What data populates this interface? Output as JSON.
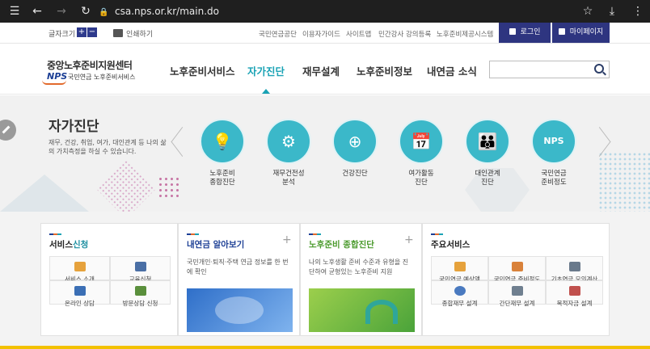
{
  "browser": {
    "url": "csa.nps.or.kr/main.do"
  },
  "util": {
    "font_size_label": "글자크기",
    "plus": "+",
    "minus": "−",
    "print_label": "인쇄하기",
    "links": [
      "국민연금공단",
      "이용자가이드",
      "사이트맵",
      "민간강사 강의등록",
      "노후준비제공시스템"
    ],
    "login": "로그인",
    "mypage": "마이페이지"
  },
  "header": {
    "logo_title": "중앙노후준비지원센터",
    "logo_nps": "NPS",
    "logo_sub": "국민연금 노후준비서비스",
    "nav": [
      "노후준비서비스",
      "자가진단",
      "재무설계",
      "노후준비정보",
      "내연금 소식"
    ],
    "search_placeholder": ""
  },
  "hero": {
    "title": "자가진단",
    "desc": "재무, 건강, 취업, 여가, 대인관계 등 나의 삶의 가치측정을 하실 수 있습니다.",
    "services": [
      {
        "label_line1": "노후준비",
        "label_line2": "종합진단",
        "icon": "lightbulb-icon",
        "glyph": "💡"
      },
      {
        "label_line1": "재무건전성",
        "label_line2": "분석",
        "icon": "gear-icon",
        "glyph": "⚙"
      },
      {
        "label_line1": "건강진단",
        "label_line2": "",
        "icon": "magnifier-plus-icon",
        "glyph": "⊕"
      },
      {
        "label_line1": "여가활동",
        "label_line2": "진단",
        "icon": "calendar-icon",
        "glyph": "📅"
      },
      {
        "label_line1": "대인관계",
        "label_line2": "진단",
        "icon": "people-icon",
        "glyph": "👪"
      },
      {
        "label_line1": "국민연금",
        "label_line2": "준비정도",
        "icon": "nps-hand-icon",
        "glyph": "NPS"
      }
    ]
  },
  "cards": {
    "service_apply": {
      "title_plain": "서비스",
      "title_hl": "신청",
      "items": [
        "서비스 소개",
        "교육신청",
        "온라인 상담",
        "방문상담 신청"
      ]
    },
    "my_pension": {
      "title": "내연금 알아보기",
      "desc": "국민개인·퇴직·주택 연금 정보를 한 번에 확인"
    },
    "overall_diag": {
      "title": "노후준비 종합진단",
      "desc": "나의 노후생활 준비 수준과 유형을 진단하여 균형있는 노후준비 지원"
    },
    "main_services": {
      "title": "주요서비스",
      "items": [
        "국민연금 예상액",
        "국민연금 준비정도",
        "기초연금 모의계산",
        "종합재무 설계",
        "간단재무 설계",
        "목적자금 설계"
      ]
    }
  },
  "colors": {
    "accent": "#1aa3b5",
    "navy": "#2e3580",
    "icon_teal": "#3bb8c9"
  }
}
